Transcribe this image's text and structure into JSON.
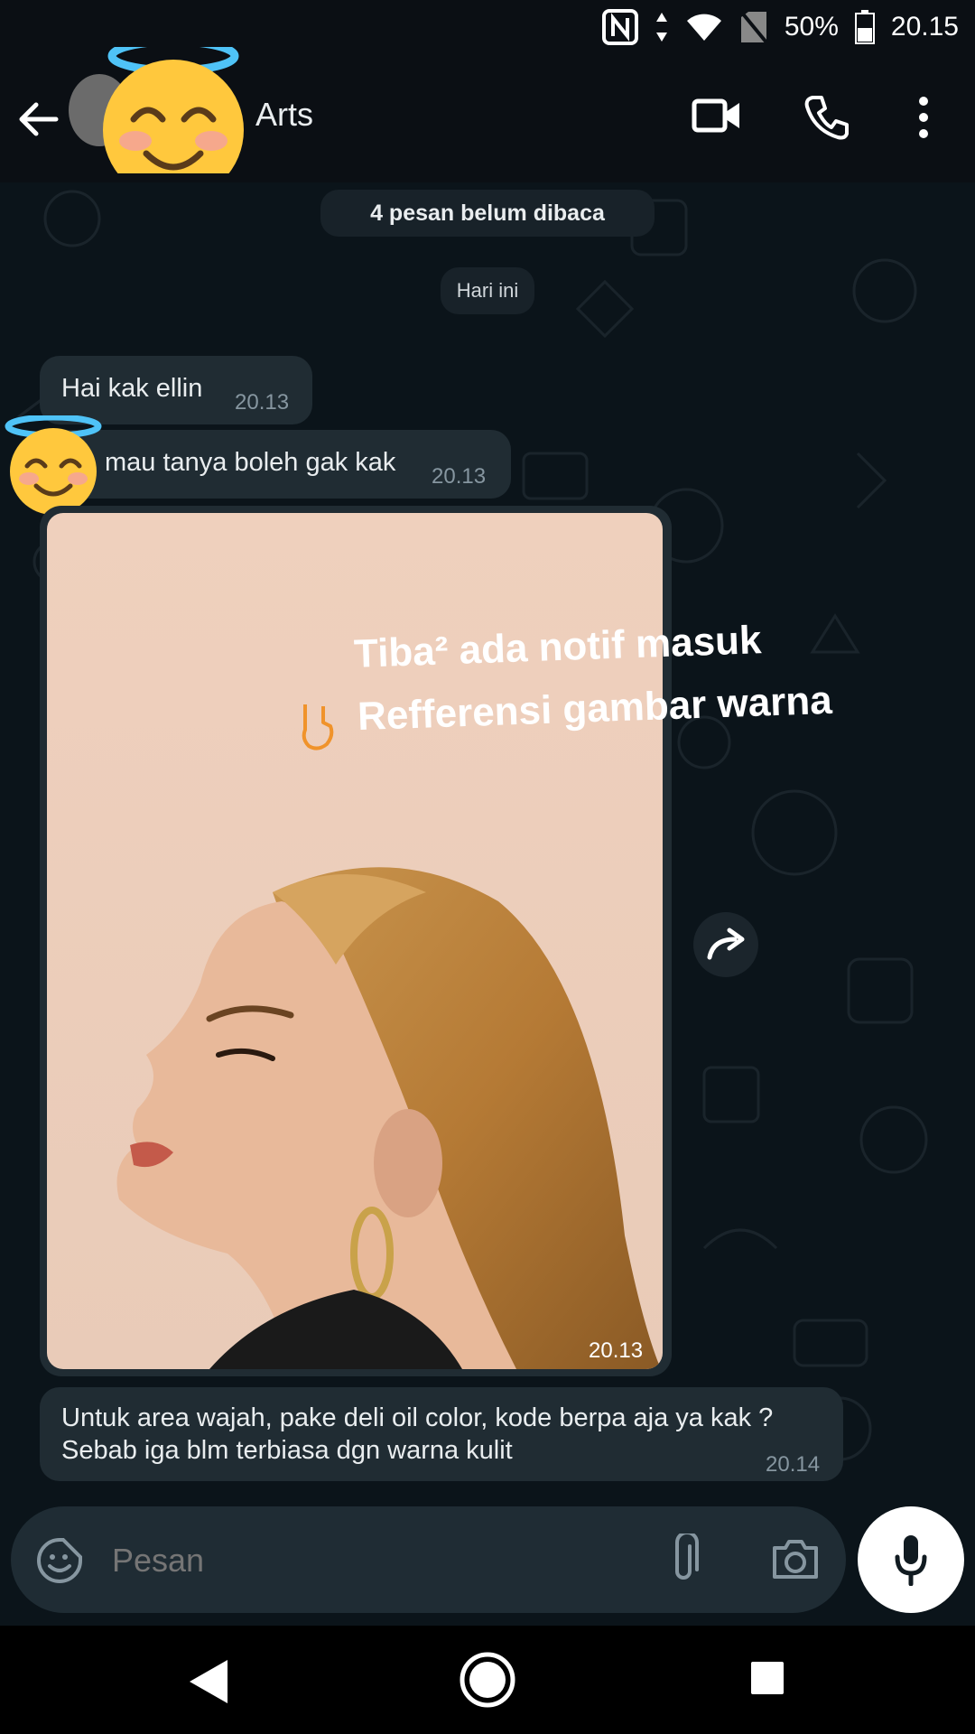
{
  "status_bar": {
    "battery_percent": "50%",
    "time": "20.15"
  },
  "header": {
    "contact_name": "Arts"
  },
  "chat": {
    "unread_banner": "4 pesan belum dibaca",
    "date_chip": "Hari ini",
    "messages": [
      {
        "text": "Hai kak ellin",
        "time": "20.13"
      },
      {
        "text": "mau tanya boleh gak kak",
        "time": "20.13"
      },
      {
        "type": "image",
        "time": "20.13",
        "overlay_line1": "Tiba² ada notif masuk",
        "overlay_line2": "Refferensi gambar warna"
      },
      {
        "line1": "Untuk area wajah, pake deli oil color, kode berpa aja ya kak ?",
        "line2": "Sebab iga blm terbiasa dgn warna kulit",
        "time": "20.14"
      }
    ]
  },
  "input": {
    "placeholder": "Pesan"
  },
  "colors": {
    "background": "#0b141a",
    "bubble": "#202c33",
    "accent_white": "#ffffff"
  }
}
